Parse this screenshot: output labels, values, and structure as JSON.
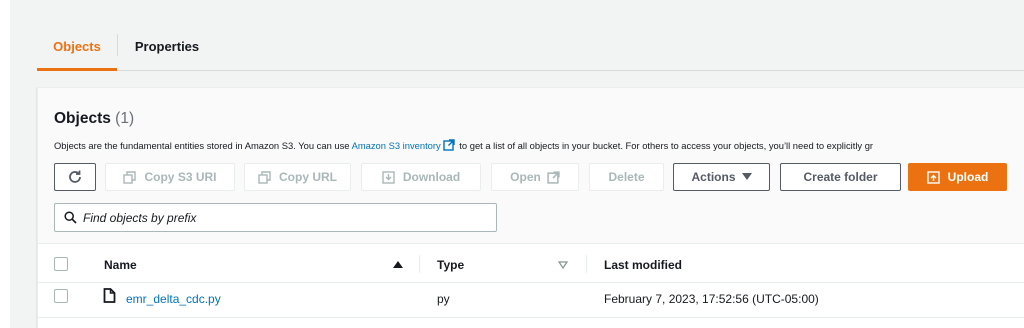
{
  "tabs": [
    {
      "label": "Objects",
      "active": true
    },
    {
      "label": "Properties",
      "active": false
    }
  ],
  "objects_panel": {
    "title": "Objects",
    "count": "(1)",
    "description_prefix": "Objects are the fundamental entities stored in Amazon S3. You can use ",
    "inventory_link": "Amazon S3 inventory",
    "description_suffix": " to get a list of all objects in your bucket. For others to access your objects, you’ll need to explicitly gr"
  },
  "toolbar": {
    "copy_s3_uri": "Copy S3 URI",
    "copy_url": "Copy URL",
    "download": "Download",
    "open": "Open",
    "delete": "Delete",
    "actions": "Actions",
    "create_folder": "Create folder",
    "upload": "Upload"
  },
  "search": {
    "placeholder": "Find objects by prefix"
  },
  "table": {
    "columns": [
      "Name",
      "Type",
      "Last modified"
    ],
    "rows": [
      {
        "name": "emr_delta_cdc.py",
        "type": "py",
        "last_modified": "February 7, 2023, 17:52:56 (UTC-05:00)"
      }
    ]
  },
  "colors": {
    "accent": "#ec7211",
    "link": "#0073bb",
    "disabled": "#aab7b8"
  },
  "icons": [
    "refresh-icon",
    "copy-icon",
    "download-icon",
    "external-link-icon",
    "caret-down-icon",
    "upload-icon",
    "search-icon",
    "sort-ascending-icon",
    "sort-descending-icon",
    "file-icon"
  ]
}
